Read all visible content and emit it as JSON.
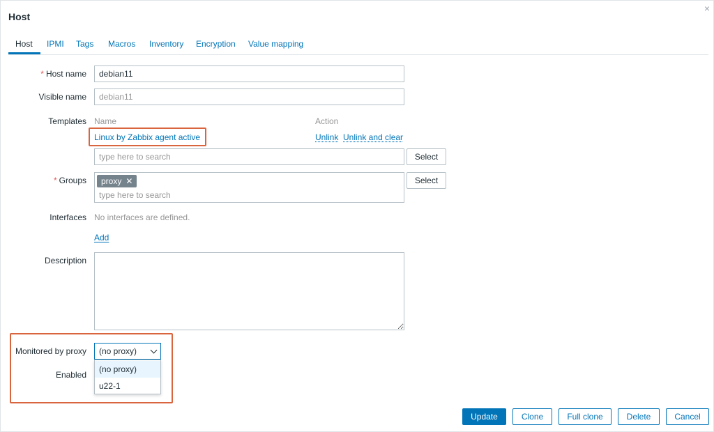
{
  "dialog": {
    "title": "Host",
    "close_label": "×"
  },
  "tabs": [
    {
      "label": "Host",
      "active": true
    },
    {
      "label": "IPMI"
    },
    {
      "label": "Tags"
    },
    {
      "label": "Macros"
    },
    {
      "label": "Inventory"
    },
    {
      "label": "Encryption"
    },
    {
      "label": "Value mapping"
    }
  ],
  "form": {
    "required_mark": "*",
    "host_name": {
      "label": "Host name",
      "value": "debian11"
    },
    "visible_name": {
      "label": "Visible name",
      "value": "debian11"
    },
    "templates": {
      "label": "Templates",
      "col_name": "Name",
      "col_action": "Action",
      "linked": [
        {
          "name": "Linux by Zabbix agent active",
          "action_unlink": "Unlink",
          "action_unlink_clear": "Unlink and clear"
        }
      ],
      "search_placeholder": "type here to search",
      "select_label": "Select"
    },
    "groups": {
      "label": "Groups",
      "chips": [
        {
          "label": "proxy",
          "remove": "✕"
        }
      ],
      "search_placeholder": "type here to search",
      "select_label": "Select"
    },
    "interfaces": {
      "label": "Interfaces",
      "empty_text": "No interfaces are defined.",
      "add_label": "Add"
    },
    "description": {
      "label": "Description",
      "value": ""
    },
    "monitored_by_proxy": {
      "label": "Monitored by proxy",
      "selected": "(no proxy)",
      "options": [
        "(no proxy)",
        "u22-1"
      ]
    },
    "enabled": {
      "label": "Enabled"
    }
  },
  "footer": {
    "update": "Update",
    "clone": "Clone",
    "full_clone": "Full clone",
    "delete": "Delete",
    "cancel": "Cancel"
  },
  "colors": {
    "accent": "#0275b8",
    "required": "#e45959",
    "highlight": "#d9653f",
    "chip": "#75838d"
  }
}
